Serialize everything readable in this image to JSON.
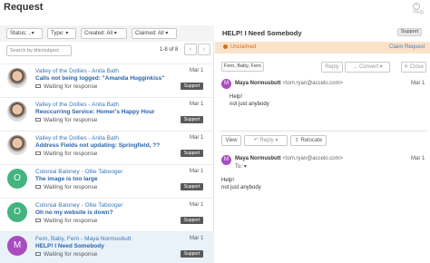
{
  "app": {
    "title": "Request",
    "help_label": "Help",
    "help_icon": "?"
  },
  "filters": {
    "status": "Status: ,",
    "type": "Type:",
    "created": "Created: All",
    "claimed": "Claimed: All"
  },
  "search": {
    "placeholder": "Search by title/subject"
  },
  "pager": {
    "text": "1-8 of 8",
    "prev": "‹",
    "next": "›"
  },
  "list": [
    {
      "company": "Valley of the Dollies",
      "contact": "Anita Bath",
      "subject": "Calls not being logged: \"Amanda Hugginkiss\"",
      "status": "Waiting for response",
      "date": "Mar 1",
      "tag": "Support",
      "avatar": "photo",
      "initial": ""
    },
    {
      "company": "Valley of the Dollies",
      "contact": "Anita Bath",
      "subject": "Reoccurring Service: Homer's Happy Hour",
      "status": "Waiting for response",
      "date": "Mar 1",
      "tag": "Support",
      "avatar": "photo",
      "initial": ""
    },
    {
      "company": "Valley of the Dollies",
      "contact": "Anita Bath",
      "subject": "Address Fields not updating: Springfield, ??",
      "status": "Waiting for response",
      "date": "Mar 1",
      "tag": "Support",
      "avatar": "photo",
      "initial": ""
    },
    {
      "company": "Colonial Baloney",
      "contact": "Ollie Tabooger",
      "subject": "The image is too large",
      "status": "Waiting for response",
      "date": "Mar 1",
      "tag": "Support",
      "avatar": "green",
      "initial": "O"
    },
    {
      "company": "Colonial Baloney",
      "contact": "Ollie Tabooger",
      "subject": "Oh no my website is down?",
      "status": "Waiting for response",
      "date": "Mar 1",
      "tag": "Support",
      "avatar": "green",
      "initial": "O"
    },
    {
      "company": "Fern, Baby, Fern",
      "contact": "Maya Normusbutt",
      "subject": "HELP! I Need Somebody",
      "status": "Waiting for response",
      "date": "Mar 1",
      "tag": "Support",
      "avatar": "purple",
      "initial": "M"
    }
  ],
  "detail": {
    "title": "HELP! I Need Somebody",
    "tag": "Support",
    "claim_status": "Unclaimed",
    "claim_action": "Claim Request",
    "company_chip": "Fern, Baby, Fern",
    "toolbar": {
      "reply": "Reply",
      "convert": "Convert",
      "close": "Close",
      "view": "View",
      "relocate": "Relocate"
    },
    "messages": [
      {
        "initial": "M",
        "name": "Maya Normusbutt",
        "email": "<tom.ryan@accelo.com>",
        "date": "Mar 1",
        "to": "",
        "body1": "Help!",
        "body2": "not just anybody"
      },
      {
        "initial": "M",
        "name": "Maya Normusbutt",
        "email": "<tom.ryan@accelo.com>",
        "date": "Mar 1",
        "to": "To:",
        "body1": "Help!",
        "body2": "not just anybody"
      }
    ]
  },
  "colors": {
    "accent": "#3b78b8",
    "banner": "#fbe3c9",
    "unclaimed": "#d46e1e",
    "avatar_green": "#43b47e",
    "avatar_purple": "#aa4cc0"
  }
}
